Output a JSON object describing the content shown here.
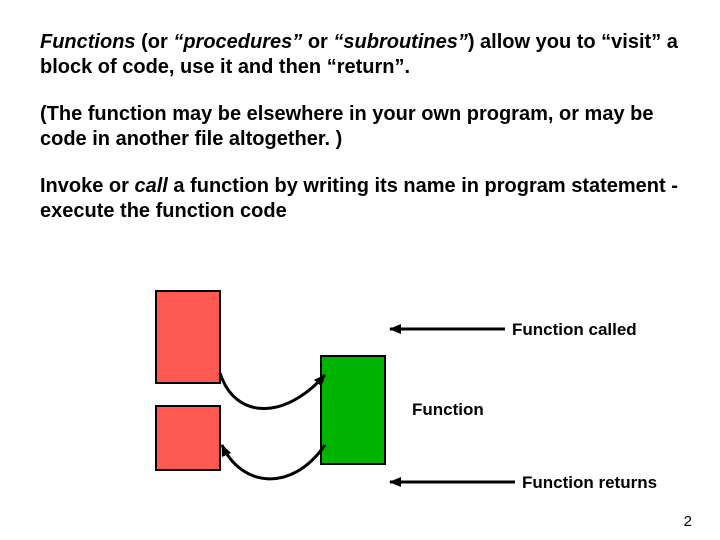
{
  "para1": {
    "w1": "Functions",
    "w2": " (or ",
    "w3": "“procedures”",
    "w4": " or ",
    "w5": "“subroutines”",
    "w6": ") allow you to “visit” a block of code, use it and then “return”."
  },
  "para2": "(The function may be elsewhere in your own program, or may be code in another file altogether. )",
  "para3": {
    "a": "Invoke or ",
    "b": "call",
    "c": " a function by writing its name in program statement - execute the function code"
  },
  "labels": {
    "called": "Function called",
    "function": "Function",
    "returns": "Function returns"
  },
  "slidenum": "2"
}
